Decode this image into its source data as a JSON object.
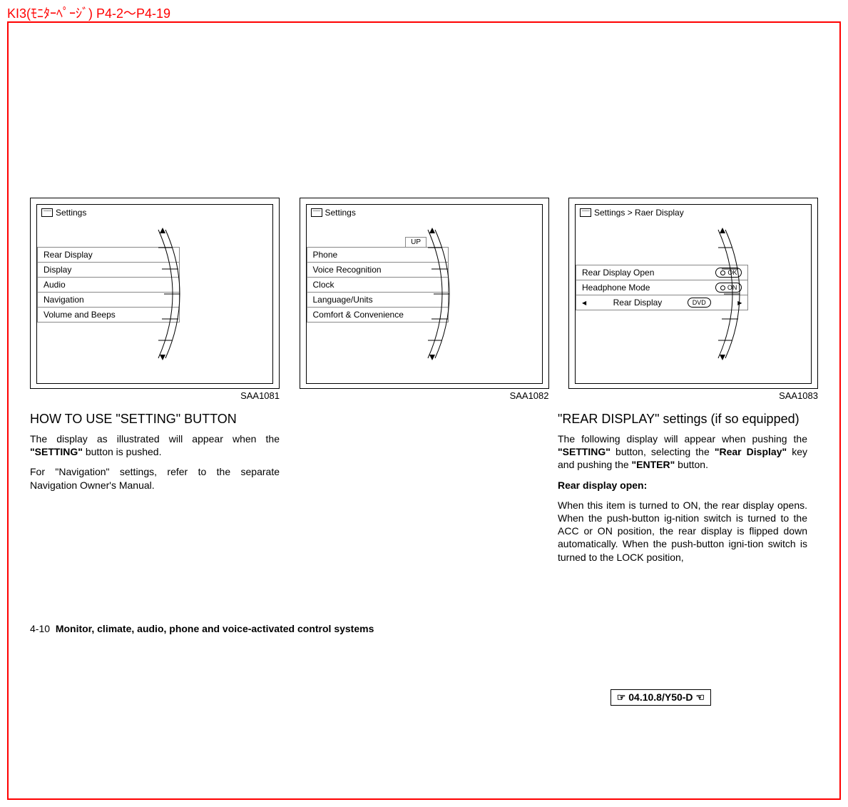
{
  "top_header": "KI3(ﾓﾆﾀｰﾍﾟｰｼﾞ) P4-2～P4-19",
  "figures": {
    "f1": {
      "id": "SAA1081",
      "title": "Settings",
      "items": [
        "Rear Display",
        "Display",
        "Audio",
        "Navigation",
        "Volume and Beeps"
      ]
    },
    "f2": {
      "id": "SAA1082",
      "title": "Settings",
      "up_label": "UP",
      "items": [
        "Phone",
        "Voice Recognition",
        "Clock",
        "Language/Units",
        "Comfort & Convenience"
      ]
    },
    "f3": {
      "id": "SAA1083",
      "title": "Settings > Raer Display",
      "items": [
        {
          "label": "Rear Display Open",
          "badge": "OK",
          "badge_type": "circle"
        },
        {
          "label": "Headphone Mode",
          "badge": "ON",
          "badge_type": "circle"
        },
        {
          "label": "Rear Display",
          "badge": "DVD",
          "badge_type": "arrows"
        }
      ]
    }
  },
  "col1": {
    "heading": "HOW TO USE \"SETTING\" BUTTON",
    "p1_a": "The display as illustrated will appear when the ",
    "p1_b": "\"SETTING\"",
    "p1_c": " button is pushed.",
    "p2": "For \"Navigation\" settings, refer to the separate Navigation Owner's Manual."
  },
  "col3": {
    "heading": "\"REAR DISPLAY\" settings (if so equipped)",
    "p1_a": "The following display will appear when pushing the ",
    "p1_b": "\"SETTING\"",
    "p1_c": " button, selecting the ",
    "p1_d": "\"Rear Display\"",
    "p1_e": " key and pushing the ",
    "p1_f": "\"ENTER\"",
    "p1_g": " button.",
    "sub": "Rear display open:",
    "p2": "When this item is turned to ON, the rear display opens. When the push-button ig-nition switch is turned to the ACC or ON position, the rear display is flipped down automatically. When the push-button igni-tion switch is turned to the LOCK position,"
  },
  "footer": {
    "page_num": "4-10",
    "section": "Monitor, climate, audio, phone and voice-activated control systems"
  },
  "stamp": "04.10.8/Y50-D"
}
